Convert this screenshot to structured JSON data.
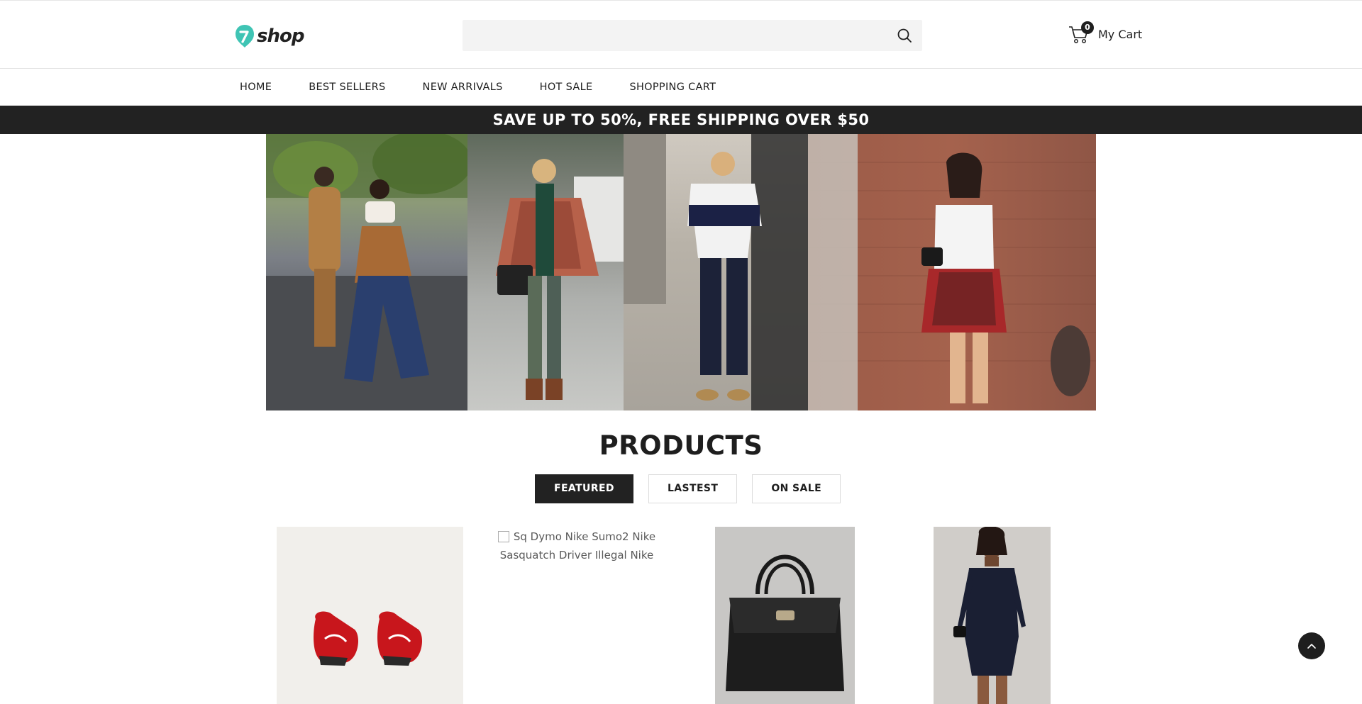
{
  "header": {
    "logo_text": "shop",
    "search_placeholder": "",
    "cart_count": "0",
    "cart_label": "My Cart"
  },
  "nav": {
    "items": [
      "HOME",
      "BEST SELLERS",
      "NEW ARRIVALS",
      "HOT SALE",
      "SHOPPING CART"
    ]
  },
  "promo": {
    "text": "SAVE UP TO 50%, FREE SHIPPING OVER $50"
  },
  "products": {
    "title": "PRODUCTS",
    "tabs": [
      "FEATURED",
      "LASTEST",
      "ON SALE"
    ],
    "active_tab": "FEATURED",
    "missing_image_alt": "Sq Dymo Nike Sumo2 Nike Sasquatch Driver Illegal Nike"
  },
  "colors": {
    "brand_teal": "#3fc4b4",
    "dark": "#222222",
    "search_bg": "#f3f3f3"
  }
}
